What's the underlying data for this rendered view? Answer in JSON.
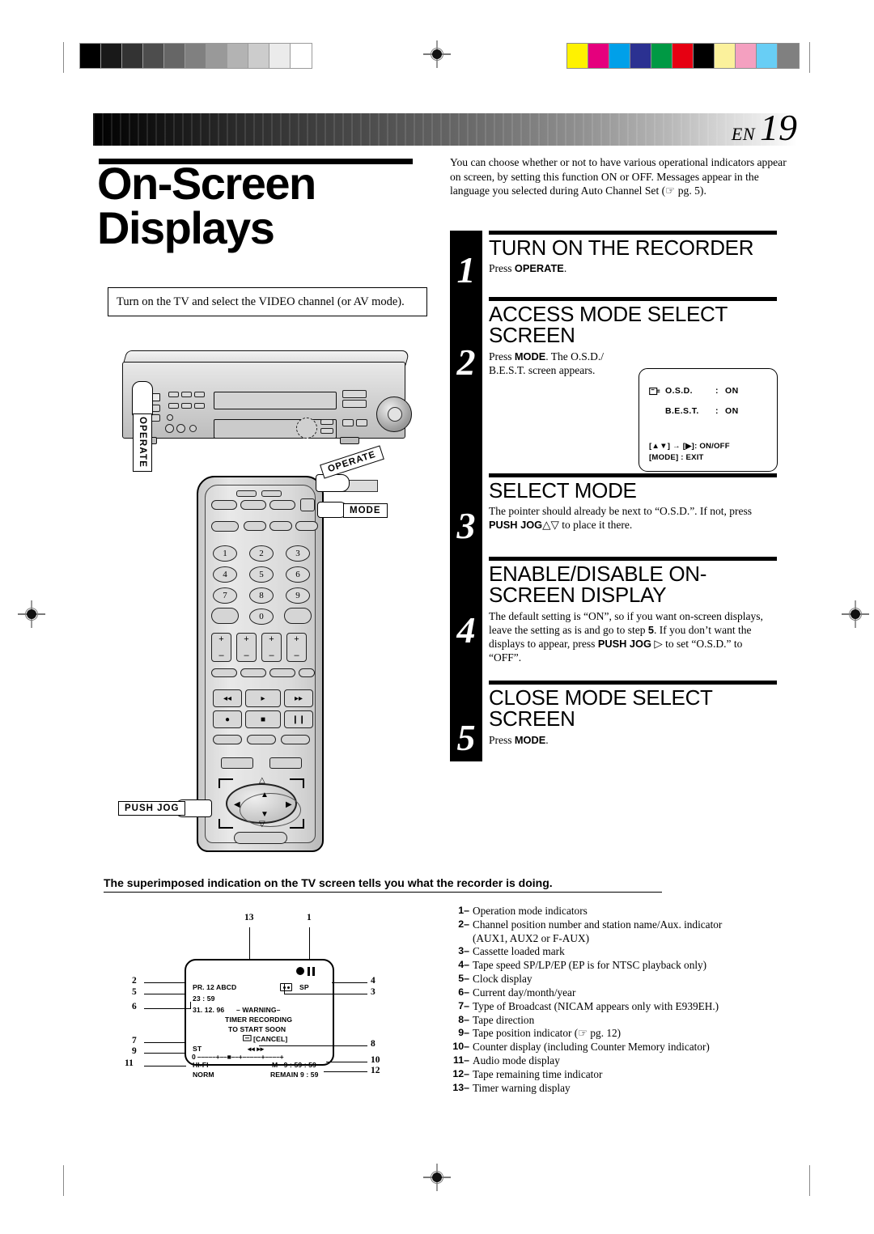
{
  "page": {
    "page_label": "EN",
    "page_number": "19",
    "title_line1": "On-Screen",
    "title_line2": "Displays",
    "prep_note": "Turn on the TV and select the VIDEO channel (or AV mode).",
    "intro": "You can choose whether or not to have various operational indicators appear on screen, by setting this function ON or OFF. Messages appear in the language you selected during Auto Channel Set (☞ pg. 5).",
    "caption": "The superimposed indication on the TV screen tells you what the recorder is doing."
  },
  "calibration": {
    "gray_swatches": [
      "#000000",
      "#191919",
      "#333333",
      "#4d4d4d",
      "#666666",
      "#808080",
      "#999999",
      "#b3b3b3",
      "#cccccc",
      "#ebebeb",
      "#ffffff"
    ],
    "color_swatches": [
      "#fff200",
      "#e5007d",
      "#00a0e9",
      "#2b3191",
      "#009944",
      "#e60012",
      "#000000",
      "#fbf19c",
      "#f4a0c0",
      "#68cef5",
      "#808080"
    ]
  },
  "steps": [
    {
      "number": "1",
      "heading": "TURN ON THE RECORDER",
      "body_pre": "Press ",
      "body_bold": "OPERATE",
      "body_post": "."
    },
    {
      "number": "2",
      "heading": "ACCESS MODE SELECT SCREEN",
      "body_pre": "Press ",
      "body_bold": "MODE",
      "body_post": ". The O.S.D./ B.E.S.T. screen appears."
    },
    {
      "number": "3",
      "heading": "SELECT MODE",
      "body_pre": "The pointer should already be next to “O.S.D.”. If not, press ",
      "body_bold": "PUSH JOG",
      "body_post": "△▽ to place it there."
    },
    {
      "number": "4",
      "heading": "ENABLE/DISABLE ON-SCREEN DISPLAY",
      "body_pre": "The default setting is “ON”, so if you want on-screen displays, leave the setting as is and go to step ",
      "body_bold": "5",
      "body_post": ". If you don’t want the displays to appear, press ",
      "body_bold2": "PUSH JOG",
      "body_post2": " ▷ to set “O.S.D.” to “OFF”."
    },
    {
      "number": "5",
      "heading": "CLOSE MODE SELECT SCREEN",
      "body_pre": "Press ",
      "body_bold": "MODE",
      "body_post": "."
    }
  ],
  "osd_menu": {
    "pointer_icon": "pointing-hand-icon",
    "row1_label": "O.S.D.",
    "row1_sep": ":",
    "row1_value": "ON",
    "row2_label": "B.E.S.T.",
    "row2_sep": ":",
    "row2_value": "ON",
    "footer1": "[▲▼] → [▶]: ON/OFF",
    "footer2": "[MODE] : EXIT"
  },
  "callouts": {
    "operate_unit": "OPERATE",
    "operate_remote": "OPERATE",
    "mode_remote": "MODE",
    "push_jog": "PUSH JOG"
  },
  "remote": {
    "numbers": [
      "1",
      "2",
      "3",
      "4",
      "5",
      "6",
      "7",
      "8",
      "9",
      "0"
    ],
    "plus": "+",
    "minus": "–"
  },
  "tv_display": {
    "channel": "PR.  12 ABCD",
    "clock": "23 : 59",
    "date": "31.  12. 96",
    "warning_head": "– WARNING–",
    "warning_line1": "TIMER RECORDING",
    "warning_line2": "TO START  SOON",
    "warning_line3": "[CANCEL]",
    "speed": "SP",
    "broadcast": "ST",
    "direction": "◂◂ ▸▸",
    "position": "0 –––––+––■––+–––––+––––+",
    "audio": "HI-FI",
    "counter": "M –9 : 59 : 59",
    "norm": "NORM",
    "remain": "REMAIN  9 : 59",
    "labels": [
      "1",
      "2",
      "3",
      "4",
      "5",
      "6",
      "7",
      "8",
      "9",
      "10",
      "11",
      "12",
      "13"
    ]
  },
  "legend": [
    {
      "n": "1–",
      "text": "Operation mode indicators"
    },
    {
      "n": "2–",
      "text": "Channel position number and station name/Aux. indicator",
      "cont": "(AUX1, AUX2 or F-AUX)"
    },
    {
      "n": "3–",
      "text": "Cassette loaded mark"
    },
    {
      "n": "4–",
      "text": "Tape speed SP/LP/EP (EP is for NTSC playback only)"
    },
    {
      "n": "5–",
      "text": "Clock display"
    },
    {
      "n": "6–",
      "text": "Current day/month/year"
    },
    {
      "n": "7–",
      "text": "Type of Broadcast (NICAM appears only with E939EH.)"
    },
    {
      "n": "8–",
      "text": "Tape direction"
    },
    {
      "n": "9–",
      "text": "Tape position indicator (☞ pg. 12)"
    },
    {
      "n": "10–",
      "text": "Counter display (including Counter Memory indicator)"
    },
    {
      "n": "11–",
      "text": "Audio mode display"
    },
    {
      "n": "12–",
      "text": "Tape remaining time indicator"
    },
    {
      "n": "13–",
      "text": "Timer warning display"
    }
  ]
}
